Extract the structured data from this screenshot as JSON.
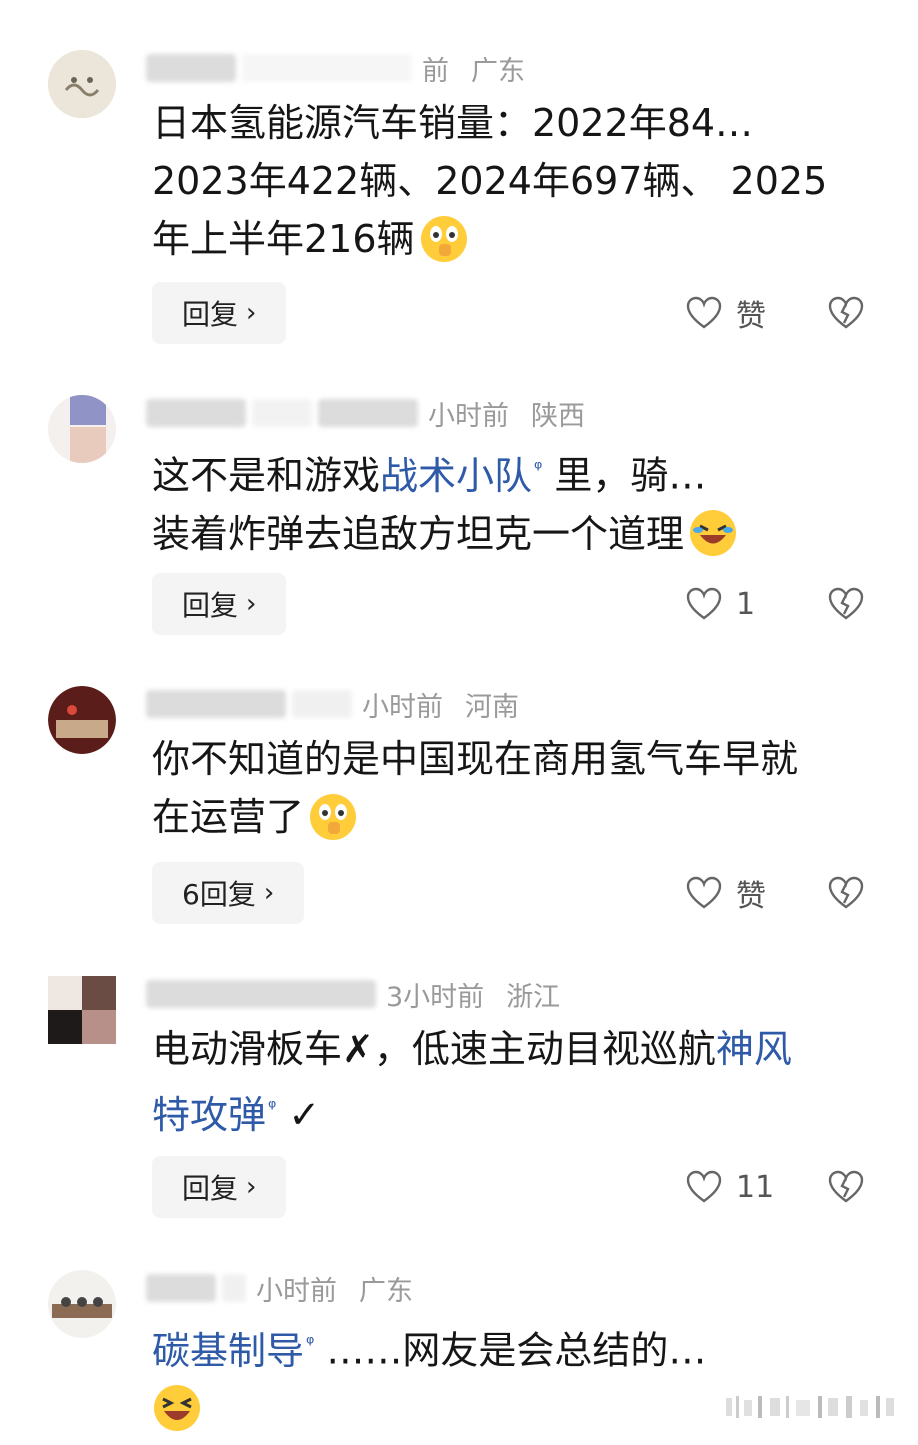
{
  "comments": [
    {
      "time": "前",
      "location": "广东",
      "lines": [
        "日本氢能源汽车销量：2022年84…",
        "2023年422辆、2024年697辆、 2025",
        "年上半年216辆"
      ],
      "reply_label": "回复",
      "like_label": "赞"
    },
    {
      "time": "小时前",
      "location": "陕西",
      "line1_pre": "这不是和游戏",
      "line1_kw": "战术小队",
      "line1_post": " 里，骑…",
      "line2": "装着炸弹去追敌方坦克一个道理",
      "reply_label": "回复",
      "like_label": "1"
    },
    {
      "time": "小时前",
      "location": "河南",
      "lines": [
        "你不知道的是中国现在商用氢气车早就",
        "在运营了"
      ],
      "reply_label": "6回复",
      "like_label": "赞"
    },
    {
      "time": "3小时前",
      "location": "浙江",
      "line1_pre": "电动滑板车",
      "line1_mark": "✗",
      "line1_mid": "，低速主动目视巡航",
      "line1_kw": "神风",
      "line2_kw": "特攻弹",
      "line2_post": " ✓",
      "reply_label": "回复",
      "like_label": "11"
    },
    {
      "time": "小时前",
      "location": "广东",
      "line1_kw": "碳基制导",
      "line1_post": " ……网友是会总结的…"
    }
  ],
  "search_icon_glyph": "ᵠ",
  "reply_chevron": "›",
  "colors": {
    "keyword": "#2e5aa8",
    "meta": "#9a9a9a",
    "text": "#161616",
    "reply_bg": "#f4f4f4"
  }
}
